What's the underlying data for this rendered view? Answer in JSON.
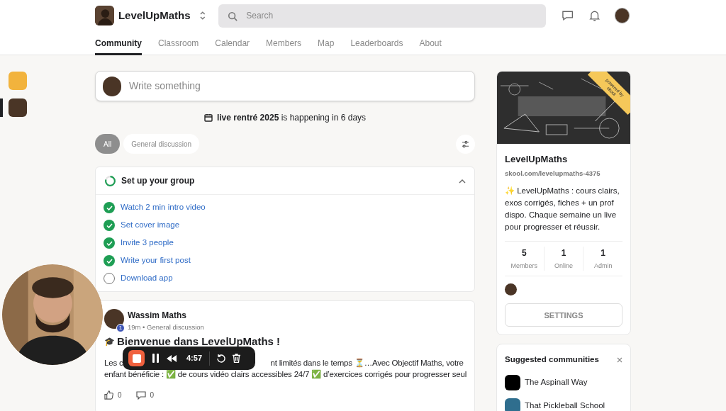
{
  "header": {
    "community_name": "LevelUpMaths",
    "search": {
      "placeholder": "Search"
    },
    "nav": [
      {
        "label": "Community",
        "selected": true
      },
      {
        "label": "Classroom",
        "selected": false
      },
      {
        "label": "Calendar",
        "selected": false
      },
      {
        "label": "Members",
        "selected": false
      },
      {
        "label": "Map",
        "selected": false
      },
      {
        "label": "Leaderboards",
        "selected": false
      },
      {
        "label": "About",
        "selected": false
      }
    ]
  },
  "left_rail": [
    {
      "selected": false,
      "color": "#f2b33d"
    },
    {
      "selected": true,
      "color": "#4a3526"
    }
  ],
  "composer": {
    "placeholder": "Write something"
  },
  "event_banner": "**live rentré 2025** is happening in 6 days",
  "filters": [
    {
      "label": "All",
      "selected": true
    },
    {
      "label": "General discussion",
      "selected": false
    }
  ],
  "setup": {
    "title": "Set up your group",
    "expanded": true,
    "tasks": [
      {
        "label": "Watch 2 min intro video",
        "done": true
      },
      {
        "label": "Set cover image",
        "done": true
      },
      {
        "label": "Invite 3 people",
        "done": true
      },
      {
        "label": "Write your first post",
        "done": true
      },
      {
        "label": "Download app",
        "done": false
      }
    ]
  },
  "post": {
    "author": "Wassim Maths",
    "level_badge": "1",
    "time": "19m",
    "separator": "•",
    "category": "General discussion",
    "title_icon": "🎓",
    "title": "Bienvenue dans LevelUpMaths !",
    "body_line_1": [
      "Les c",
      "nt limités dans le temps ⏳…Avec Objectif Maths, votre"
    ],
    "body_line_2": "enfant bénéficie : ✅ de cours vidéo clairs accessibles 24/7 ✅ d’exercices corrigés pour progresser seul",
    "likes": "0",
    "comments": "0"
  },
  "recorder": {
    "time": "4:57"
  },
  "about": {
    "ribbon": "powered by skool",
    "name": "LevelUpMaths",
    "url": "skool.com/levelupmaths-4375",
    "description": "✨ LevelUpMaths : cours clairs, exos corrigés, fiches + un prof dispo. Chaque semaine un live pour progresser et réussir.",
    "stats": [
      {
        "value": "5",
        "label": "Members"
      },
      {
        "value": "1",
        "label": "Online"
      },
      {
        "value": "1",
        "label": "Admin"
      }
    ],
    "button": "SETTINGS"
  },
  "suggested": {
    "title": "Suggested communities",
    "items": [
      {
        "name": "The Aspinall Way",
        "color": "#000000"
      },
      {
        "name": "That Pickleball School",
        "color": "#2f6e8e"
      }
    ]
  }
}
